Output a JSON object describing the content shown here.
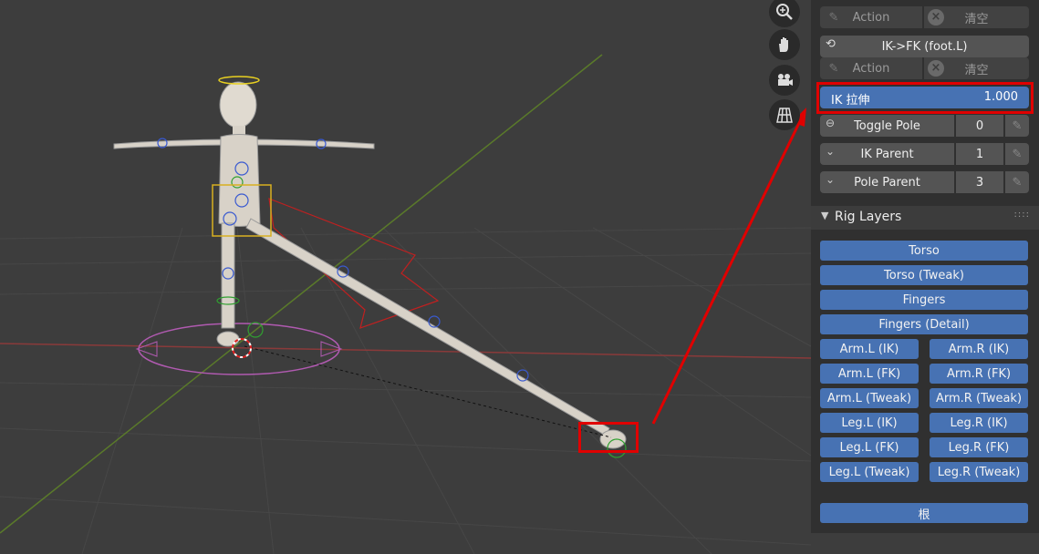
{
  "viewport": {
    "nav_icons": [
      "zoom-icon",
      "hand-icon",
      "camera-icon",
      "grid-icon"
    ]
  },
  "panel": {
    "top_row": {
      "action_label": "Action",
      "clear_label": "清空"
    },
    "ik_fk_button": {
      "label": "IK->FK (foot.L)",
      "icon": "magnet-icon"
    },
    "action_row": {
      "action_label": "Action",
      "clear_label": "清空"
    },
    "ik_stretch": {
      "label": "IK 拉伸",
      "value": "1.000",
      "fraction": 1.0
    },
    "toggle_pole": {
      "label": "Toggle Pole",
      "value": "0"
    },
    "ik_parent": {
      "label": "IK Parent",
      "value": "1"
    },
    "pole_parent": {
      "label": "Pole Parent",
      "value": "3"
    }
  },
  "rig_layers": {
    "title": "Rig Layers",
    "full_rows": [
      "Torso",
      "Torso (Tweak)",
      "Fingers",
      "Fingers (Detail)"
    ],
    "pairs": [
      [
        "Arm.L (IK)",
        "Arm.R (IK)"
      ],
      [
        "Arm.L (FK)",
        "Arm.R (FK)"
      ],
      [
        "Arm.L (Tweak)",
        "Arm.R (Tweak)"
      ],
      [
        "Leg.L (IK)",
        "Leg.R (IK)"
      ],
      [
        "Leg.L (FK)",
        "Leg.R (FK)"
      ],
      [
        "Leg.L (Tweak)",
        "Leg.R (Tweak)"
      ]
    ],
    "root": "根"
  },
  "colors": {
    "viewport_bg": "#3d3d3d",
    "panel_bg": "#303030",
    "accent_blue": "#4772b3",
    "highlight_red": "#e00000"
  }
}
